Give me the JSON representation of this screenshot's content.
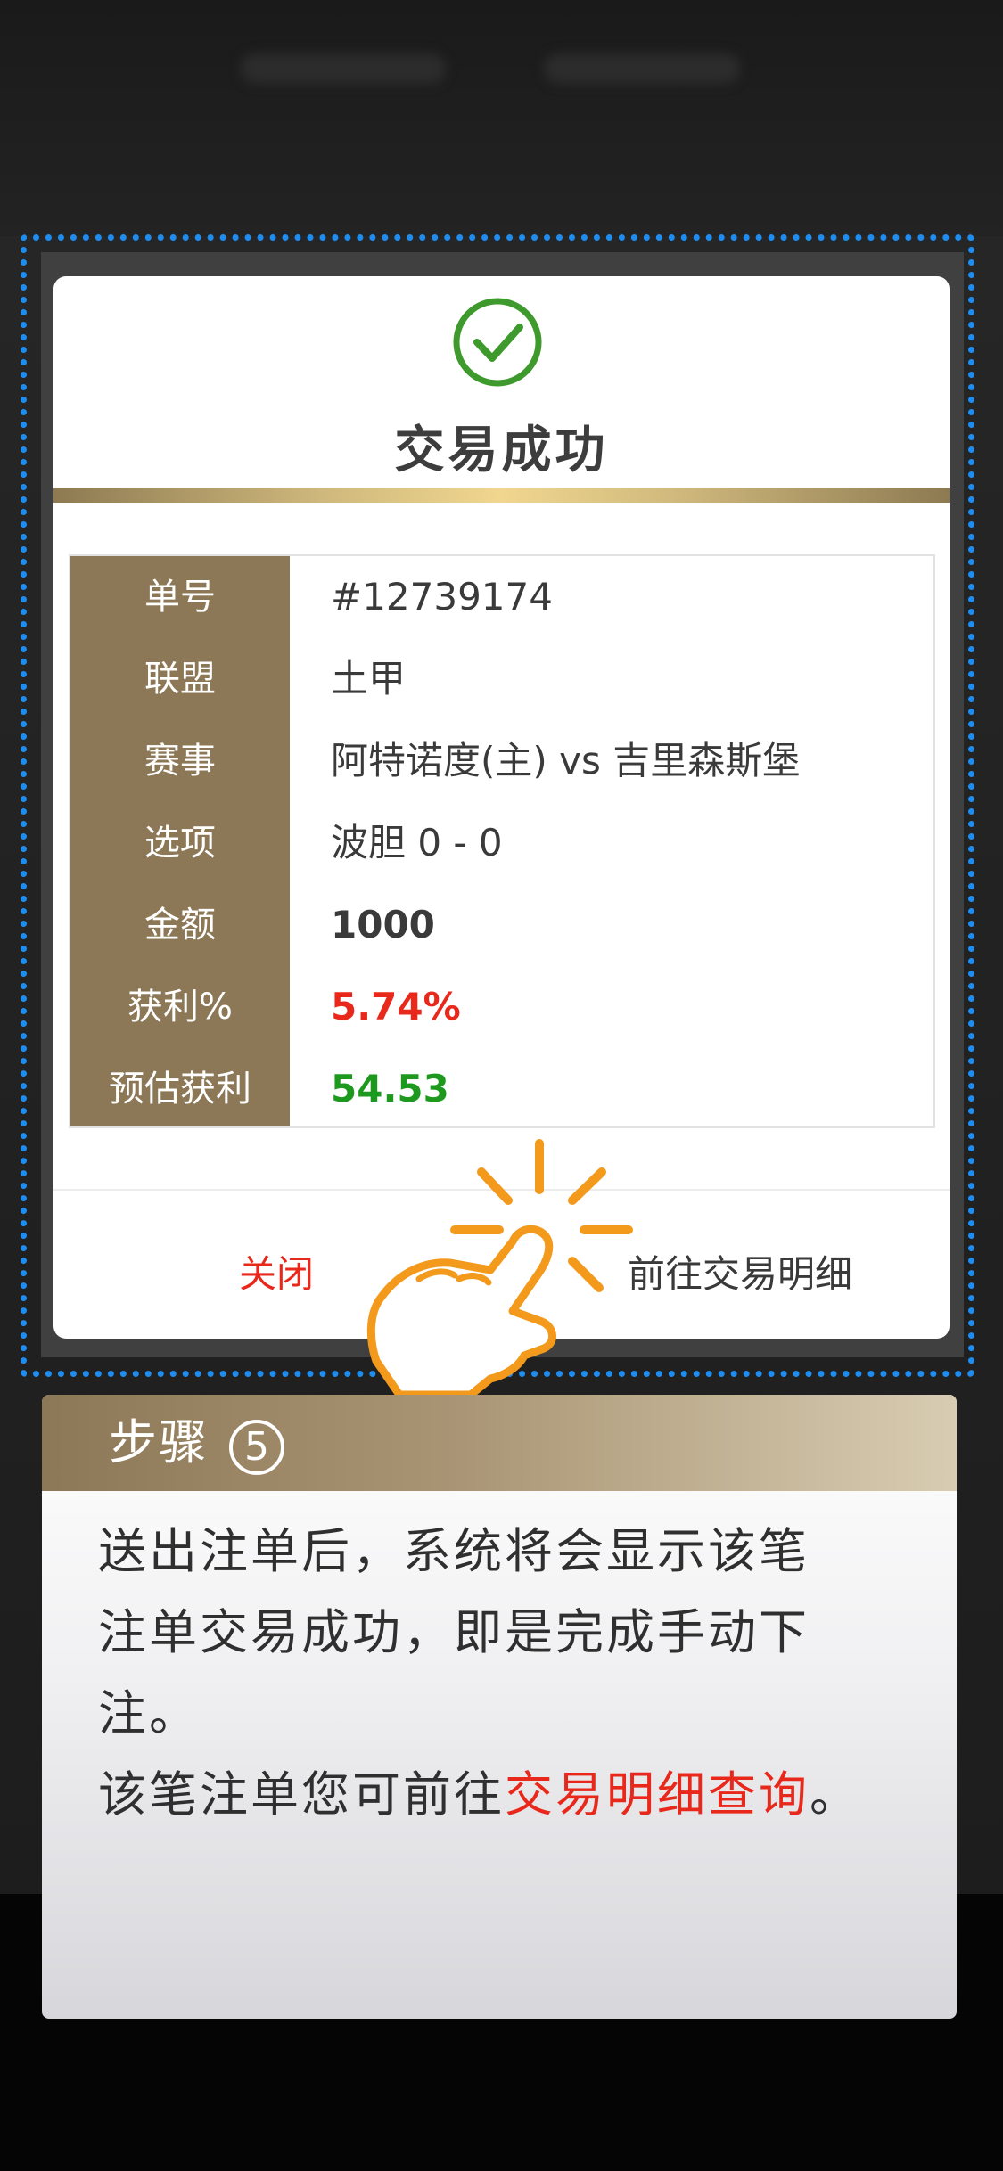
{
  "dialog": {
    "title": "交易成功",
    "rows": [
      {
        "label": "单号",
        "value": "#12739174"
      },
      {
        "label": "联盟",
        "value": "土甲"
      },
      {
        "label": "赛事",
        "value": "阿特诺度(主) vs 吉里森斯堡"
      },
      {
        "label": "选项",
        "value": "波胆 0 - 0"
      },
      {
        "label": "金额",
        "value": "1000"
      },
      {
        "label": "获利%",
        "value": "5.74%"
      },
      {
        "label": "预估获利",
        "value": "54.53"
      }
    ],
    "close_label": "关闭",
    "detail_label": "前往交易明细"
  },
  "step": {
    "title": "步骤",
    "number": "5",
    "line1": "送出注单后，系统将会显示该笔",
    "line2": "注单交易成功，即是完成手动下",
    "line3": "注。",
    "line4_prefix": "该笔注单您可前往",
    "line4_highlight": "交易明细查询",
    "line4_suffix": "。"
  },
  "colors": {
    "accent_gold": "#8c7856",
    "success_green": "#3e9a2c",
    "highlight_red": "#e8281b",
    "profit_green": "#1d9a1d",
    "dotted_blue": "#1f8df0",
    "hand_orange": "#f39a1c"
  },
  "icons": {
    "success": "check-circle-icon",
    "pointer": "tapping-hand-icon"
  }
}
